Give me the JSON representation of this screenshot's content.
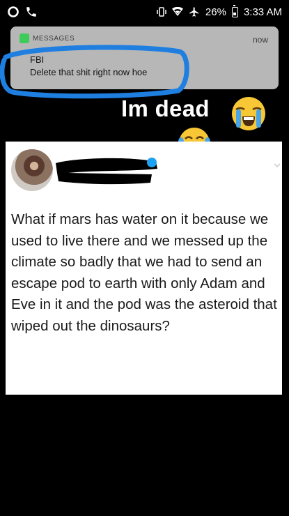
{
  "status_bar": {
    "battery": "26%",
    "time": "3:33 AM",
    "icons": [
      "circle-notification-icon",
      "phone-icon",
      "vibrate-icon",
      "wifi-icon",
      "airplane-icon",
      "battery-icon"
    ]
  },
  "notification": {
    "app": "MESSAGES",
    "time": "now",
    "sender": "FBI",
    "body": "Delete that shit right now hoe",
    "app_icon_color": "#3fcb5a"
  },
  "caption": {
    "text": "Im  dead",
    "emojis": [
      "loudly-crying-face-emoji",
      "tears-of-joy-emoji"
    ]
  },
  "tweet": {
    "text": "What if mars has water on it because we used to live there and we messed up the climate so badly that we had to send an escape pod to earth with only Adam and Eve in it and the pod was the asteroid that wiped out the dinosaurs?",
    "redaction_color": "#000000",
    "scribble_color": "#1f7fe0"
  }
}
